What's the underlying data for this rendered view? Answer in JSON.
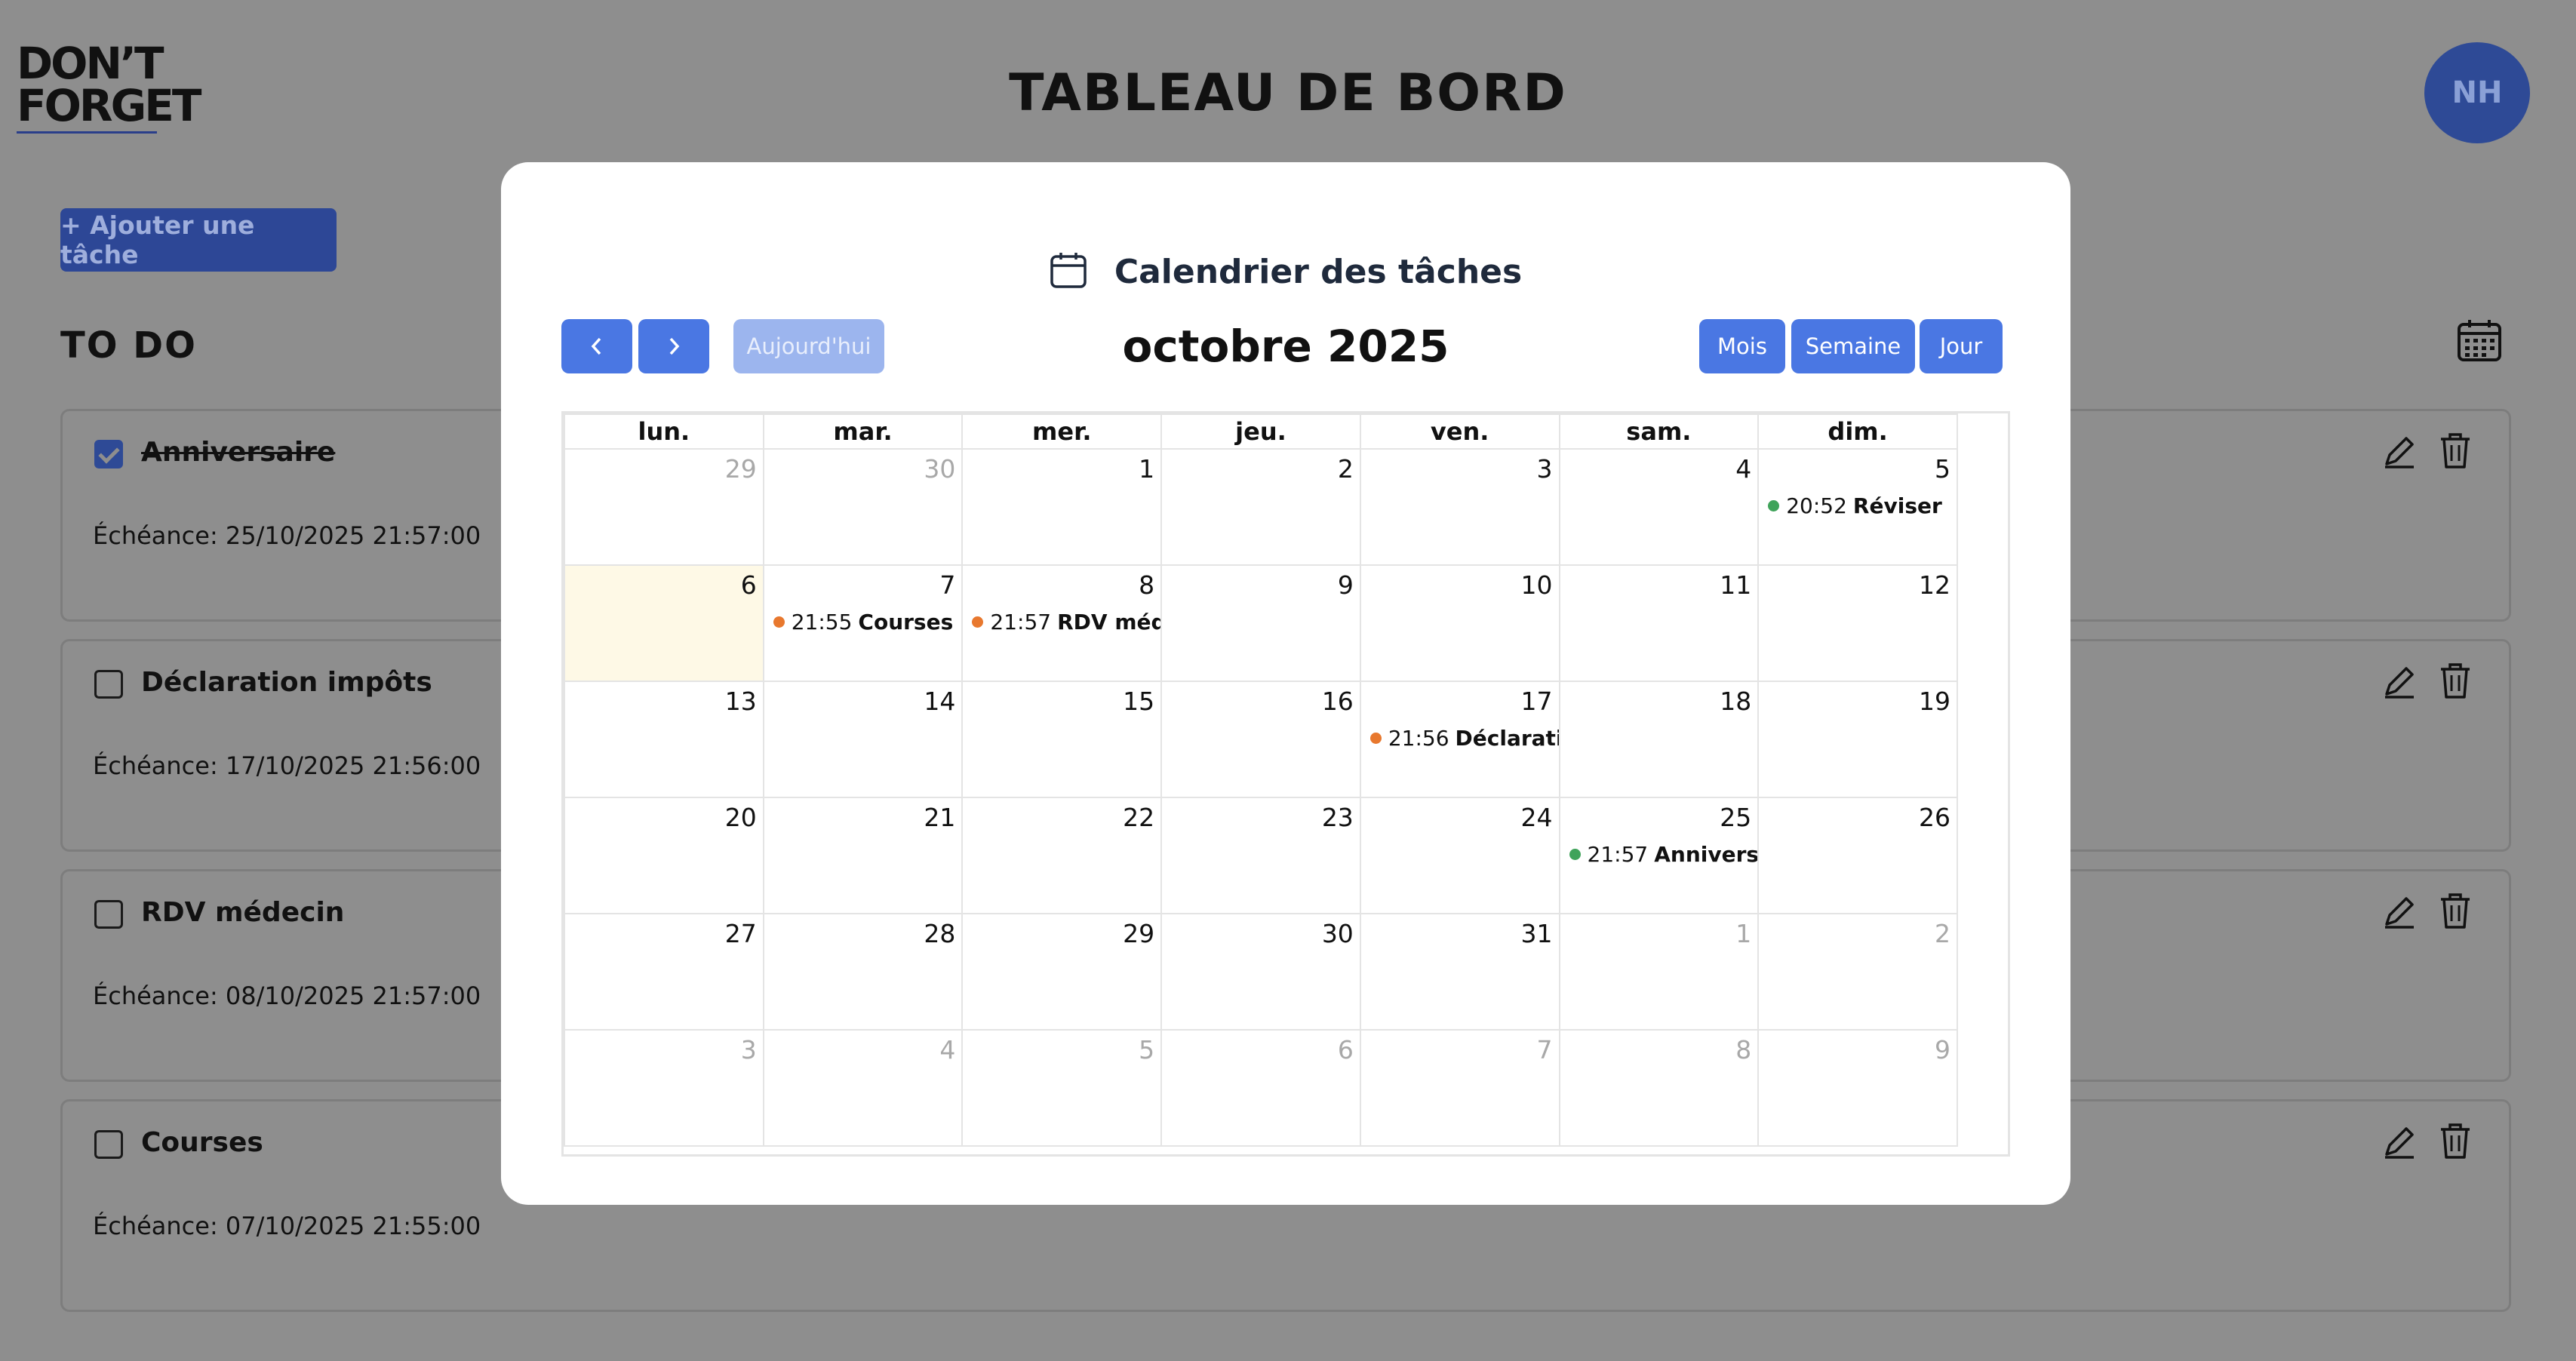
{
  "app": {
    "logo_line1": "DON’T",
    "logo_line2": "FORGET",
    "page_title": "TABLEAU DE BORD",
    "avatar_initials": "NH"
  },
  "toolbar": {
    "add_task_label": "+ Ajouter une tâche",
    "section_title": "TO DO",
    "calendar_toggle_icon": "calendar-grid-icon"
  },
  "tasks": [
    {
      "name": "Anniversaire",
      "done": true,
      "due": "Échéance: 25/10/2025 21:57:00"
    },
    {
      "name": "Déclaration impôts",
      "done": false,
      "due": "Échéance: 17/10/2025 21:56:00"
    },
    {
      "name": "RDV médecin",
      "done": false,
      "due": "Échéance: 08/10/2025 21:57:00"
    },
    {
      "name": "Courses",
      "done": false,
      "due": "Échéance: 07/10/2025 21:55:00"
    }
  ],
  "modal": {
    "title": "Calendrier des tâches",
    "title_icon": "calendar-icon",
    "prev_icon": "chevron-left-icon",
    "next_icon": "chevron-right-icon",
    "today_label": "Aujourd'hui",
    "month_label": "octobre 2025",
    "view_month": "Mois",
    "view_week": "Semaine",
    "view_day": "Jour",
    "weekdays": [
      "lun.",
      "mar.",
      "mer.",
      "jeu.",
      "ven.",
      "sam.",
      "dim."
    ],
    "weeks": [
      [
        {
          "d": "29",
          "other": true
        },
        {
          "d": "30",
          "other": true
        },
        {
          "d": "1"
        },
        {
          "d": "2"
        },
        {
          "d": "3"
        },
        {
          "d": "4"
        },
        {
          "d": "5",
          "event": {
            "time": "20:52",
            "title": "Réviser",
            "color": "#3fa35a"
          }
        }
      ],
      [
        {
          "d": "6",
          "today": true
        },
        {
          "d": "7",
          "event": {
            "time": "21:55",
            "title": "Courses",
            "color": "#e8782e"
          }
        },
        {
          "d": "8",
          "event": {
            "time": "21:57",
            "title": "RDV médecin",
            "color": "#e8782e"
          }
        },
        {
          "d": "9"
        },
        {
          "d": "10"
        },
        {
          "d": "11"
        },
        {
          "d": "12"
        }
      ],
      [
        {
          "d": "13"
        },
        {
          "d": "14"
        },
        {
          "d": "15"
        },
        {
          "d": "16"
        },
        {
          "d": "17",
          "event": {
            "time": "21:56",
            "title": "Déclaration impôts",
            "color": "#e8782e"
          }
        },
        {
          "d": "18"
        },
        {
          "d": "19"
        }
      ],
      [
        {
          "d": "20"
        },
        {
          "d": "21"
        },
        {
          "d": "22"
        },
        {
          "d": "23"
        },
        {
          "d": "24"
        },
        {
          "d": "25",
          "event": {
            "time": "21:57",
            "title": "Anniversaire",
            "color": "#3fa35a"
          }
        },
        {
          "d": "26"
        }
      ],
      [
        {
          "d": "27"
        },
        {
          "d": "28"
        },
        {
          "d": "29"
        },
        {
          "d": "30"
        },
        {
          "d": "31"
        },
        {
          "d": "1",
          "other": true
        },
        {
          "d": "2",
          "other": true
        }
      ],
      [
        {
          "d": "3",
          "other": true
        },
        {
          "d": "4",
          "other": true
        },
        {
          "d": "5",
          "other": true
        },
        {
          "d": "6",
          "other": true
        },
        {
          "d": "7",
          "other": true
        },
        {
          "d": "8",
          "other": true
        },
        {
          "d": "9",
          "other": true
        }
      ]
    ]
  },
  "colors": {
    "accent": "#4a77e3",
    "overlay": "#8e8e8e",
    "today_bg": "#fef9e6",
    "event_done": "#3fa35a",
    "event_pending": "#e8782e"
  }
}
